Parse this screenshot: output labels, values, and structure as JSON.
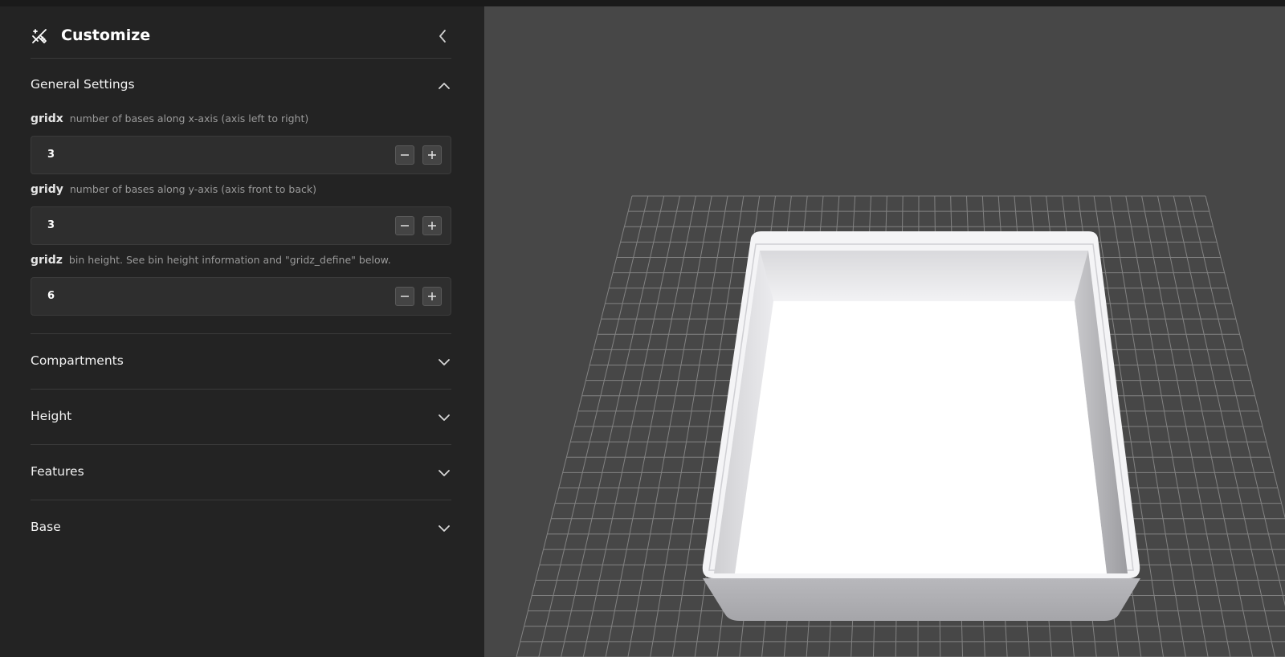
{
  "header": {
    "title": "Customize",
    "logo_icon": "wand-ruler-icon",
    "collapse_icon": "chevron-left-icon"
  },
  "general_settings": {
    "label": "General Settings",
    "expanded": true,
    "params": [
      {
        "name": "gridx",
        "description": "number of bases along x-axis (axis left to right)",
        "value": "3"
      },
      {
        "name": "gridy",
        "description": "number of bases along y-axis (axis front to back)",
        "value": "3"
      },
      {
        "name": "gridz",
        "description": "bin height. See bin height information and \"gridz_define\" below.",
        "value": "6"
      }
    ]
  },
  "sections": [
    {
      "label": "Compartments",
      "expanded": false
    },
    {
      "label": "Height",
      "expanded": false
    },
    {
      "label": "Features",
      "expanded": false
    },
    {
      "label": "Base",
      "expanded": false
    }
  ],
  "colors": {
    "sidebar_bg": "#232323",
    "viewport_bg": "#474747",
    "grid_line": "#8a8a8a",
    "model": "#ffffff"
  }
}
